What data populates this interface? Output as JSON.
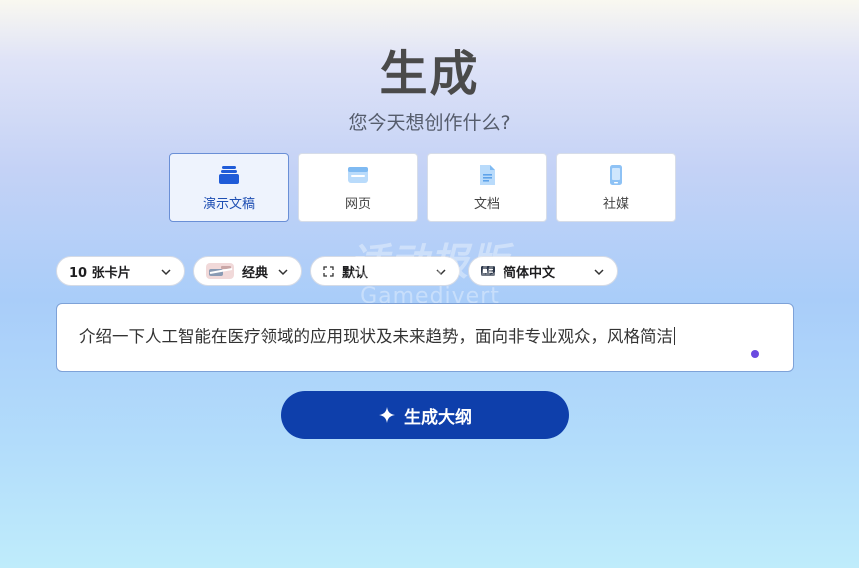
{
  "header": {
    "title": "生成",
    "subtitle": "您今天想创作什么?"
  },
  "types": [
    {
      "label": "演示文稿",
      "icon": "presentation-stack-icon",
      "active": true
    },
    {
      "label": "网页",
      "icon": "webpage-icon",
      "active": false
    },
    {
      "label": "文档",
      "icon": "document-icon",
      "active": false
    },
    {
      "label": "社媒",
      "icon": "mobile-phone-icon",
      "active": false
    }
  ],
  "controls": {
    "cards": "10 张卡片",
    "theme": "经典",
    "size": "默认",
    "language": "简体中文"
  },
  "prompt": {
    "value": "介绍一下人工智能在医疗领域的应用现状及未来趋势，面向非专业观众，风格简洁"
  },
  "generate_button": {
    "label": "生成大纲"
  },
  "watermark": {
    "cn": "适动报版",
    "en": "Gamedivert"
  },
  "colors": {
    "accent": "#0e3fab",
    "active_card_bg": "#eef3fd",
    "active_card_border": "#6a8fd6",
    "active_icon": "#1f5bd8",
    "inactive_icon": "#8ec2f5"
  }
}
